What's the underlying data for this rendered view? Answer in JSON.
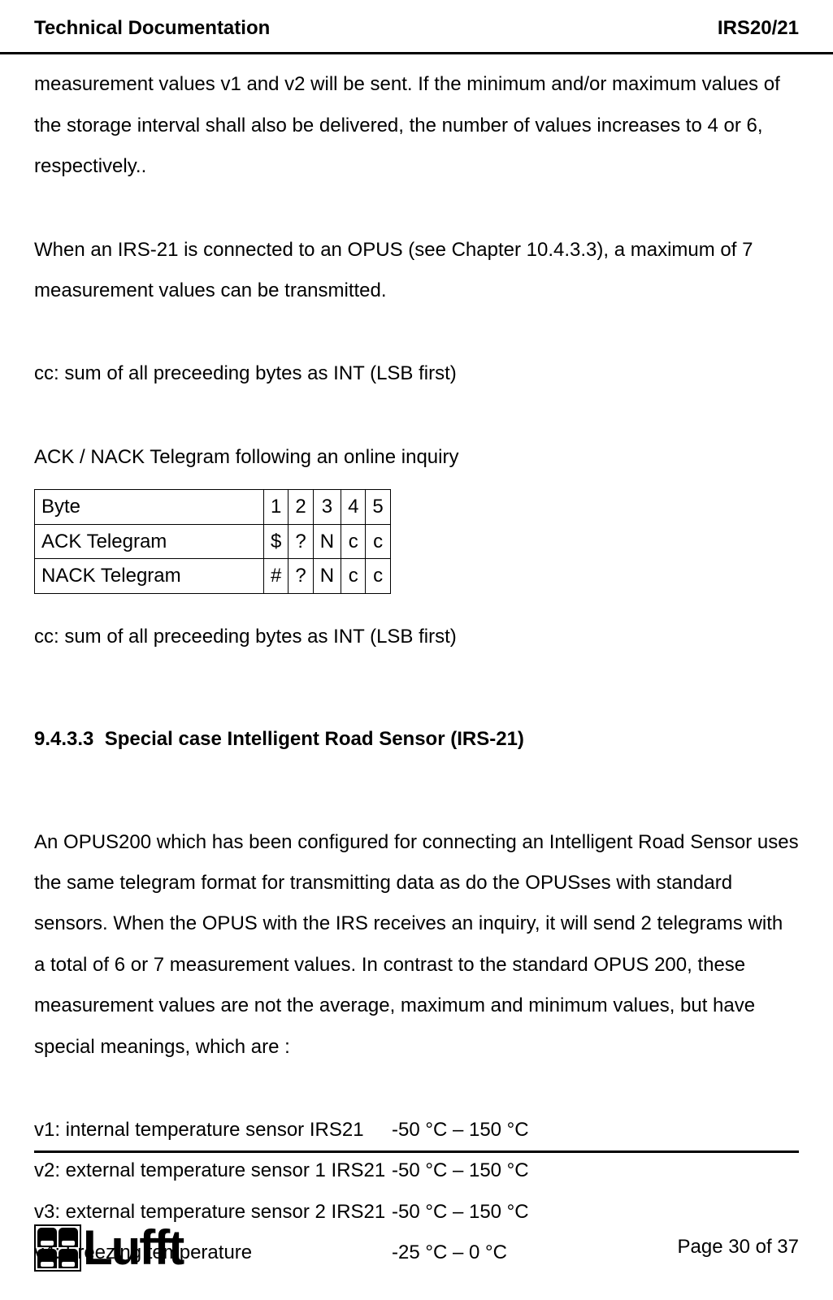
{
  "header": {
    "left": "Technical Documentation",
    "right": "IRS20/21"
  },
  "body": {
    "p1": "measurement values v1 and v2 will be sent. If the minimum and/or maximum values of the storage interval shall also be delivered, the number of values increases to 4 or 6, respectively..",
    "p2": "When an IRS-21 is connected to an OPUS (see Chapter 10.4.3.3), a maximum of 7 measurement values can be transmitted.",
    "p3": "cc: sum of all preceeding bytes as INT (LSB first)",
    "p4": "ACK / NACK Telegram following an online inquiry",
    "p5": "cc: sum of all preceeding bytes as INT (LSB first)",
    "p6": "An OPUS200 which has been configured for connecting an Intelligent Road Sensor uses the same telegram format for transmitting data as do the OPUSses with standard sensors. When the OPUS with the IRS receives an inquiry, it will send 2 telegrams with a total of 6 or 7 measurement values. In contrast to the standard OPUS 200, these measurement values are not the average, maximum and minimum values, but have special meanings, which are :"
  },
  "table": {
    "rows": [
      [
        "Byte",
        "1",
        "2",
        "3",
        "4",
        "5"
      ],
      [
        "ACK Telegram",
        "$",
        "?",
        "N",
        "c",
        "c"
      ],
      [
        "NACK Telegram",
        "#",
        "?",
        "N",
        "c",
        "c"
      ]
    ]
  },
  "section": {
    "num": "9.4.3.3",
    "title": "Special case Intelligent Road Sensor (IRS-21)"
  },
  "vvalues": {
    "items": [
      {
        "k": "v1: internal temperature sensor IRS21",
        "v": "-50 °C – 150 °C"
      },
      {
        "k": "v2: external temperature sensor 1 IRS21",
        "v": "-50 °C – 150 °C"
      },
      {
        "k": "v3: external temperature sensor 2 IRS21",
        "v": "-50 °C – 150 °C"
      },
      {
        "k": "v4: Freezing temperature",
        "v": "-25 °C – 0 °C"
      }
    ]
  },
  "footer": {
    "logo_text": "Lufft",
    "page": "Page 30 of 37"
  }
}
